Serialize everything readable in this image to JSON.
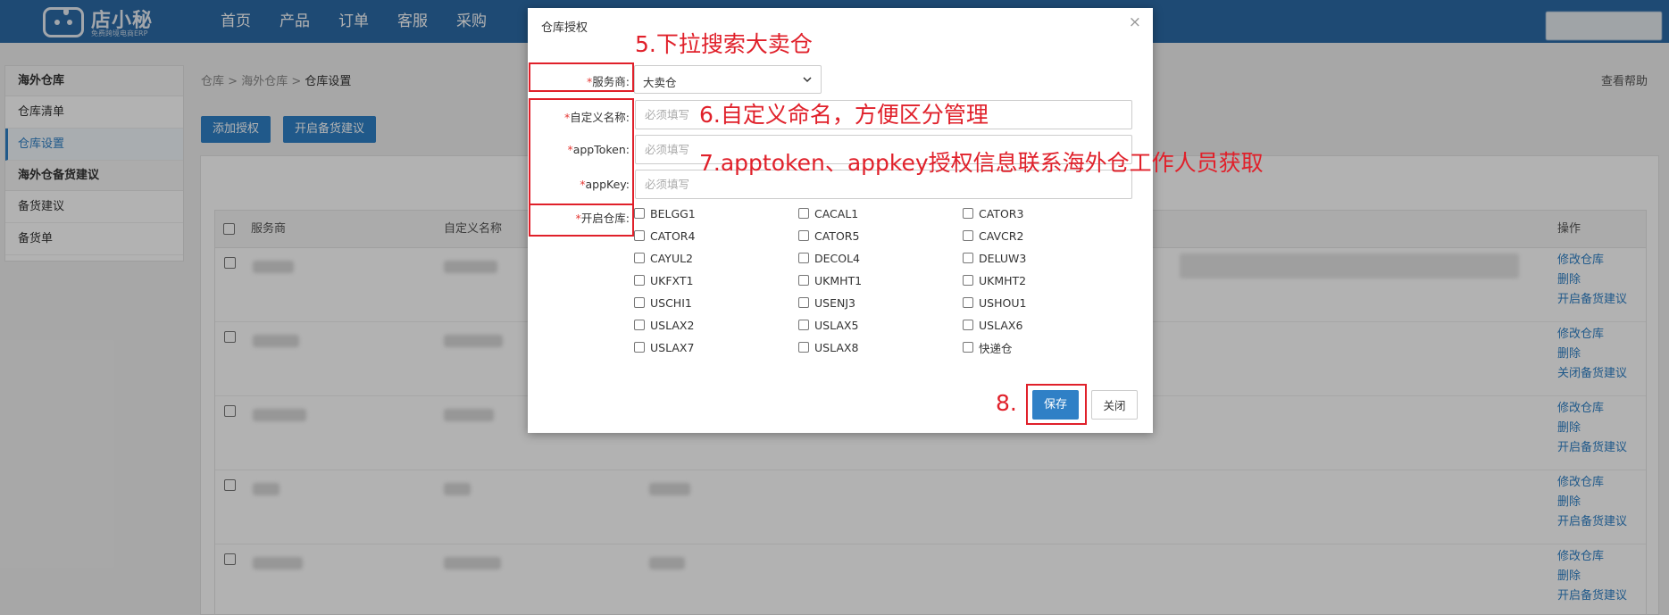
{
  "topnav": {
    "logo_name": "店小秘",
    "logo_sub": "免费跨境电商ERP",
    "items": [
      "首页",
      "产品",
      "订单",
      "客服",
      "采购"
    ]
  },
  "sidebar": {
    "group1": "海外仓库",
    "items1": [
      "仓库清单",
      "仓库设置"
    ],
    "group2": "海外仓备货建议",
    "items2": [
      "备货建议",
      "备货单"
    ]
  },
  "breadcrumb": {
    "part1": "仓库",
    "sep": " > ",
    "part2": "海外仓库",
    "current": "仓库设置"
  },
  "help_link": "查看帮助",
  "toolbar": {
    "add_auth": "添加授权",
    "enable_stock": "开启备货建议"
  },
  "table": {
    "headers": {
      "provider": "服务商",
      "custom_name": "自定义名称",
      "ops": "操作"
    },
    "rows": [
      {
        "ops": [
          "修改仓库",
          "删除",
          "开启备货建议"
        ]
      },
      {
        "ops": [
          "修改仓库",
          "删除",
          "关闭备货建议"
        ]
      },
      {
        "ops": [
          "修改仓库",
          "删除",
          "开启备货建议"
        ]
      },
      {
        "ops": [
          "修改仓库",
          "删除",
          "开启备货建议"
        ]
      },
      {
        "ops": [
          "修改仓库",
          "删除",
          "开启备货建议"
        ]
      }
    ]
  },
  "modal": {
    "title": "仓库授权",
    "close_glyph": "×",
    "required_mark": "*",
    "labels": {
      "provider": "服务商:",
      "custom_name": "自定义名称:",
      "app_token": "appToken:",
      "app_key": "appKey:",
      "warehouses": "开启仓库:"
    },
    "provider_value": "大卖仓",
    "placeholder": "必须填写",
    "warehouses": [
      "BELGG1",
      "CACAL1",
      "CATOR3",
      "CATOR4",
      "CATOR5",
      "CAVCR2",
      "CAYUL2",
      "DECOL4",
      "DELUW3",
      "UKFXT1",
      "UKMHT1",
      "UKMHT2",
      "USCHI1",
      "USENJ3",
      "USHOU1",
      "USLAX2",
      "USLAX5",
      "USLAX6",
      "USLAX7",
      "USLAX8",
      "快递仓"
    ],
    "save": "保存",
    "close": "关闭"
  },
  "annotations": {
    "step5": "5.下拉搜索大卖仓",
    "step6": "6.自定义命名，方便区分管理",
    "step7": "7.apptoken、appkey授权信息联系海外仓工作人员获取",
    "step8": "8."
  },
  "colors": {
    "nav": "#2c6aa6",
    "primary": "#2f80c6",
    "annotation": "#e0202a",
    "required": "#e53935"
  }
}
